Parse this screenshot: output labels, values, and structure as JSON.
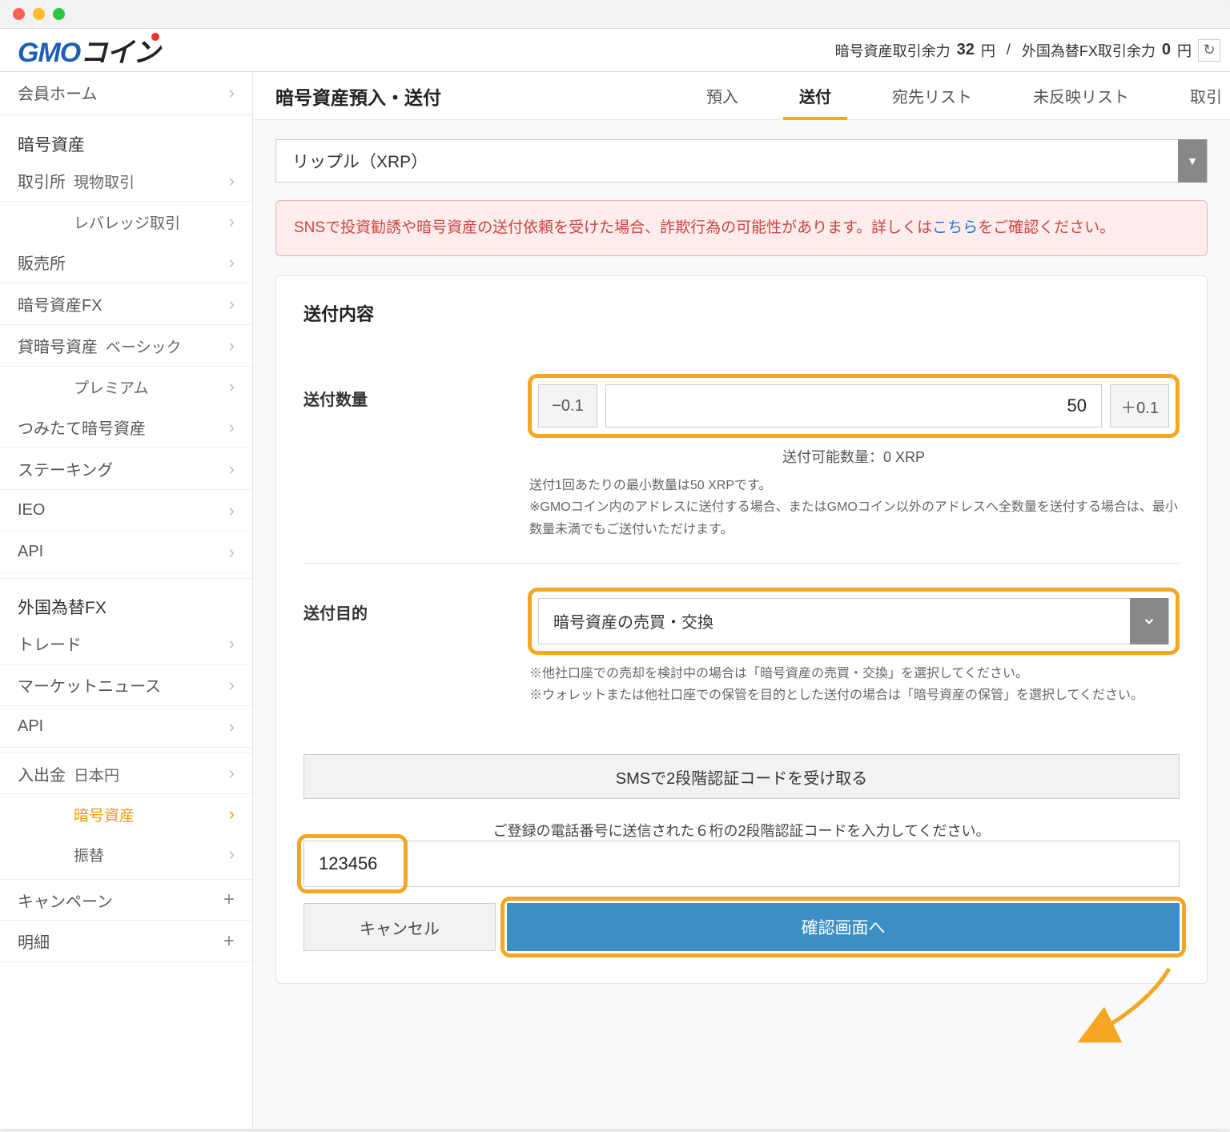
{
  "header": {
    "balance1_label": "暗号資産取引余力",
    "balance1_value": "32",
    "balance1_unit": "円",
    "separator": "/",
    "balance2_label": "外国為替FX取引余力",
    "balance2_value": "0",
    "balance2_unit": "円"
  },
  "sidebar": {
    "home": "会員ホーム",
    "cat1": "暗号資産",
    "spot": "取引所",
    "spot2": "現物取引",
    "leverage": "レバレッジ取引",
    "sales": "販売所",
    "fx": "暗号資産FX",
    "lending": "貸暗号資産",
    "lending2": "ベーシック",
    "premium": "プレミアム",
    "tsumitate": "つみたて暗号資産",
    "staking": "ステーキング",
    "ieo": "IEO",
    "api1": "API",
    "cat2": "外国為替FX",
    "trade": "トレード",
    "news": "マーケットニュース",
    "api2": "API",
    "deposit": "入出金",
    "jpy": "日本円",
    "crypto": "暗号資産",
    "transfer": "振替",
    "campaign": "キャンペーン",
    "detail": "明細"
  },
  "content": {
    "title": "暗号資産預入・送付",
    "tabs": {
      "deposit": "預入",
      "send": "送付",
      "addresses": "宛先リスト",
      "pending": "未反映リスト",
      "trade": "取引"
    },
    "crypto_selected": "リップル（XRP）",
    "warning_pre": "SNSで投資勧誘や暗号資産の送付依頼を受けた場合、詐欺行為の可能性があります。詳しくは",
    "warning_link": "こちら",
    "warning_post": "をご確認ください。",
    "panel_title": "送付内容",
    "qty": {
      "label": "送付数量",
      "minus": "−0.1",
      "plus": "＋0.1",
      "value": "50",
      "available": "送付可能数量：0 XRP",
      "help1": "送付1回あたりの最小数量は50 XRPです。",
      "help2": "※GMOコイン内のアドレスに送付する場合、またはGMOコイン以外のアドレスへ全数量を送付する場合は、最小数量未満でもご送付いただけます。"
    },
    "purpose": {
      "label": "送付目的",
      "selected": "暗号資産の売買・交換",
      "help1": "※他社口座での売却を検討中の場合は「暗号資産の売買・交換」を選択してください。",
      "help2": "※ウォレットまたは他社口座での保管を目的とした送付の場合は「暗号資産の保管」を選択してください。"
    },
    "auth": {
      "sms_btn": "SMSで2段階認証コードを受け取る",
      "instruction": "ご登録の電話番号に送信された６桁の2段階認証コードを入力してください。",
      "code_value": "123456",
      "cancel": "キャンセル",
      "confirm": "確認画面へ"
    }
  }
}
